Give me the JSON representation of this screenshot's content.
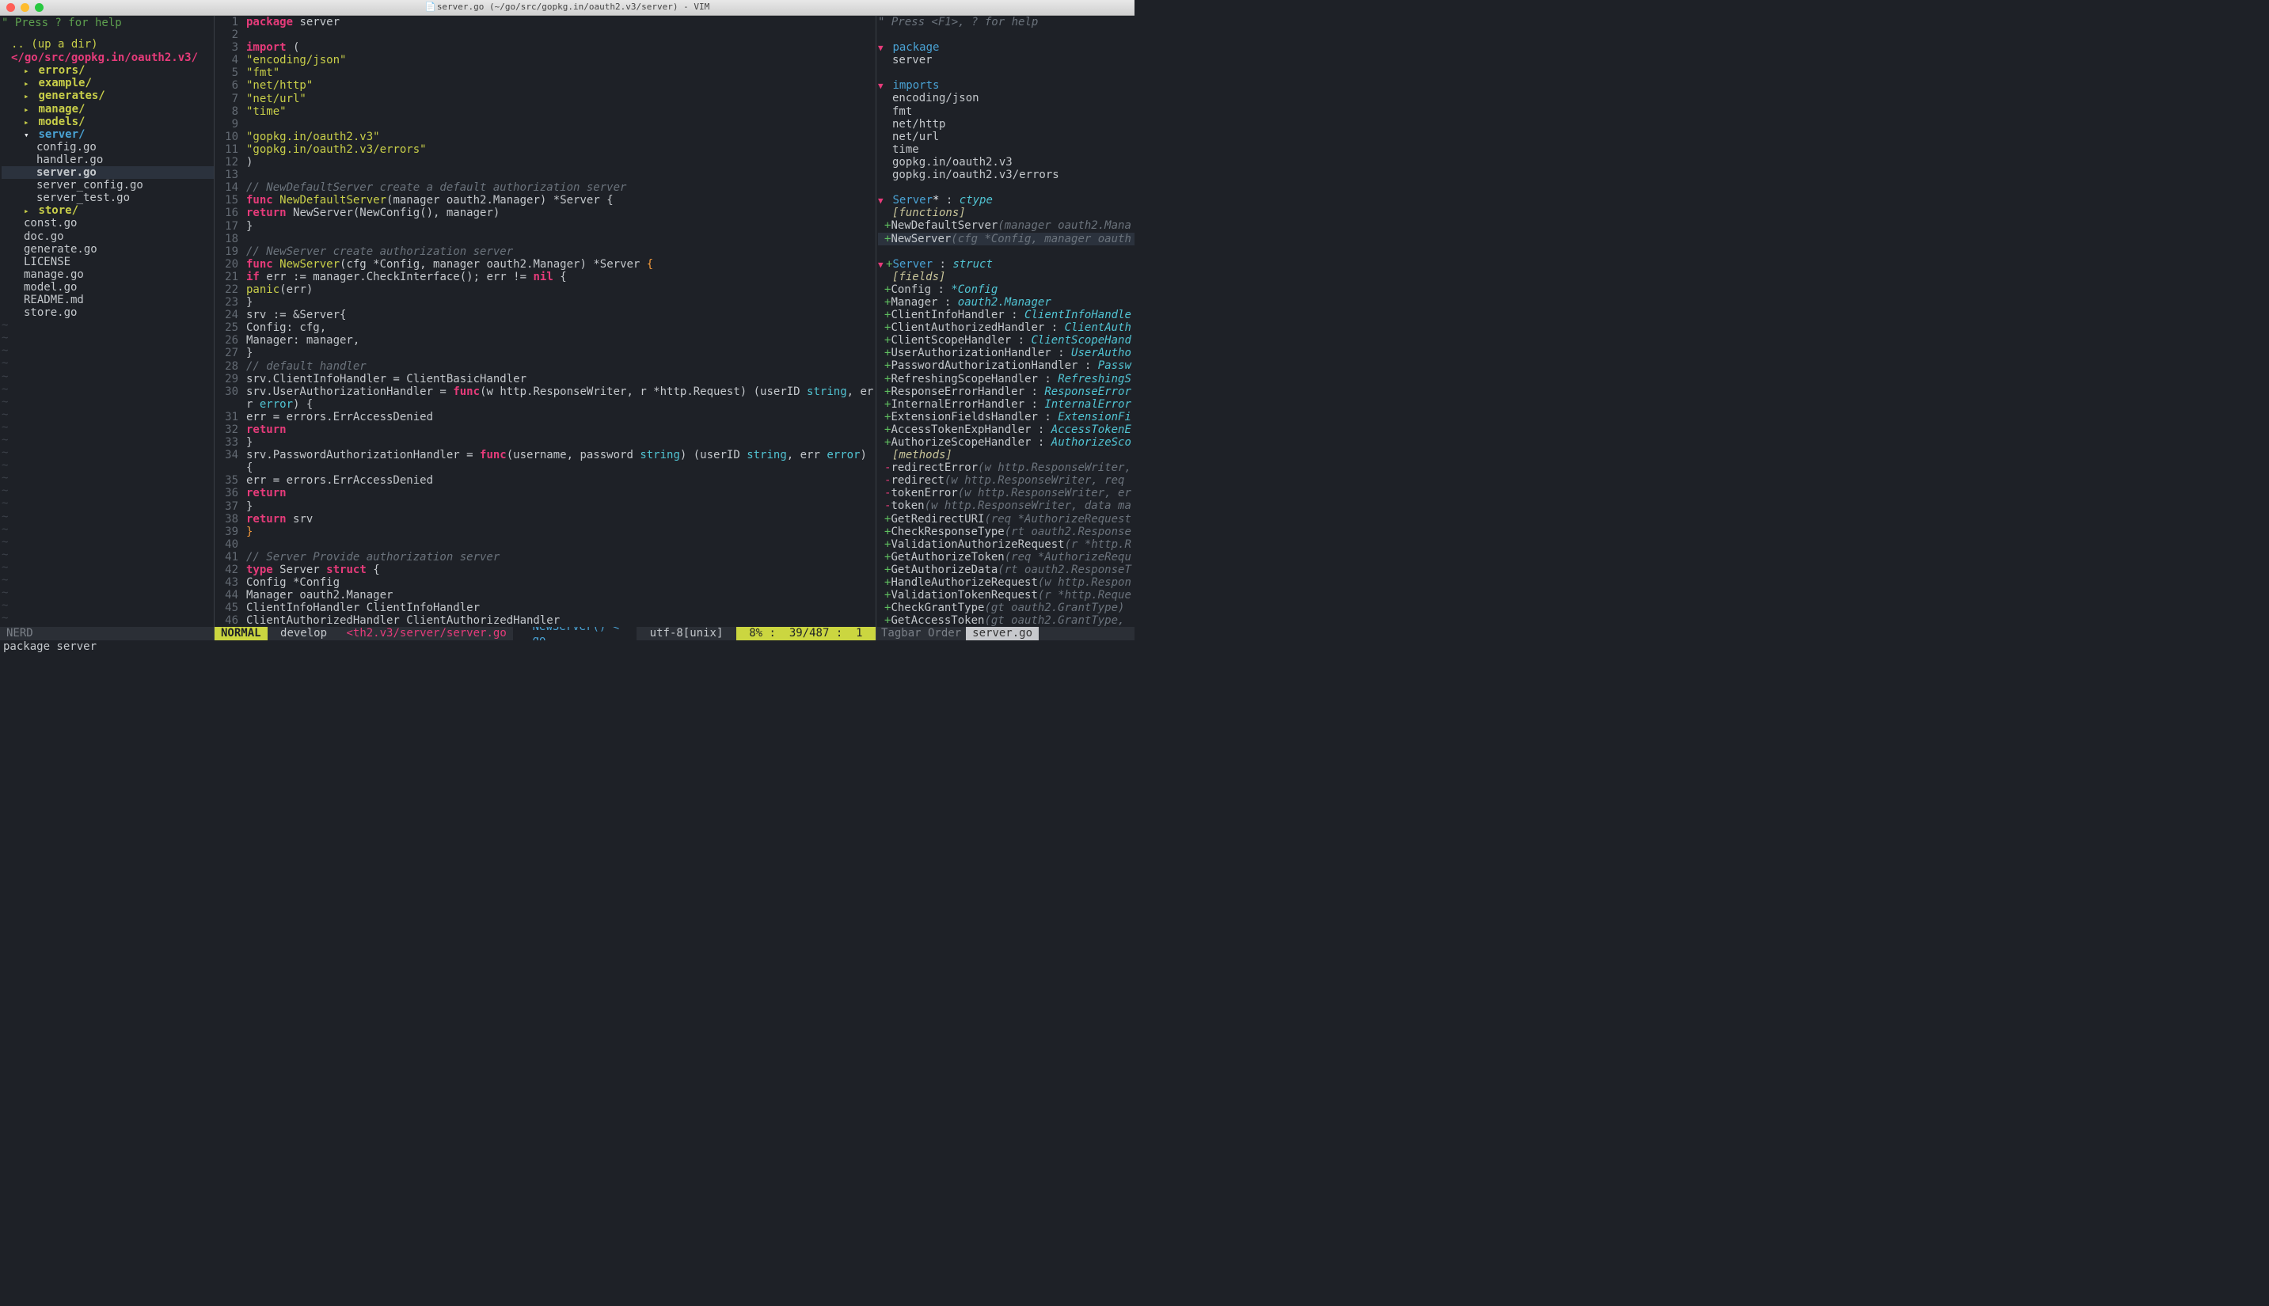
{
  "title": "server.go (~/go/src/gopkg.in/oauth2.v3/server) - VIM",
  "nerd": {
    "hint": "\" Press ? for help",
    "up": ".. (up a dir)",
    "root": "</go/src/gopkg.in/oauth2.v3/",
    "tree": [
      {
        "type": "dir",
        "name": "errors/",
        "expand": "right",
        "indent": 1
      },
      {
        "type": "dir",
        "name": "example/",
        "expand": "right",
        "indent": 1
      },
      {
        "type": "dir",
        "name": "generates/",
        "expand": "right",
        "indent": 1
      },
      {
        "type": "dir",
        "name": "manage/",
        "expand": "right",
        "indent": 1
      },
      {
        "type": "dir",
        "name": "models/",
        "expand": "right",
        "indent": 1
      },
      {
        "type": "dircur",
        "name": "server/",
        "expand": "down",
        "indent": 1
      },
      {
        "type": "file",
        "name": "config.go",
        "indent": 2
      },
      {
        "type": "file",
        "name": "handler.go",
        "indent": 2
      },
      {
        "type": "file",
        "name": "server.go",
        "indent": 2,
        "selected": true
      },
      {
        "type": "file",
        "name": "server_config.go",
        "indent": 2
      },
      {
        "type": "file",
        "name": "server_test.go",
        "indent": 2
      },
      {
        "type": "dir",
        "name": "store/",
        "expand": "right",
        "indent": 1
      },
      {
        "type": "file",
        "name": "const.go",
        "indent": 1
      },
      {
        "type": "file",
        "name": "doc.go",
        "indent": 1
      },
      {
        "type": "file",
        "name": "generate.go",
        "indent": 1
      },
      {
        "type": "file",
        "name": "LICENSE",
        "indent": 1
      },
      {
        "type": "file",
        "name": "manage.go",
        "indent": 1
      },
      {
        "type": "file",
        "name": "model.go",
        "indent": 1
      },
      {
        "type": "file",
        "name": "README.md",
        "indent": 1
      },
      {
        "type": "file",
        "name": "store.go",
        "indent": 1
      }
    ],
    "status": {
      "label": "NERD",
      "powerline": ""
    }
  },
  "code": {
    "lines": [
      {
        "n": "1",
        "h": "<span class='kw'>package</span> <span class='pl'>server</span>"
      },
      {
        "n": "2",
        "h": ""
      },
      {
        "n": "3",
        "h": "<span class='kw'>import</span> <span class='pl'>(</span>"
      },
      {
        "n": "4",
        "h": "    <span class='str'>\"encoding/json\"</span>"
      },
      {
        "n": "5",
        "h": "    <span class='str'>\"fmt\"</span>"
      },
      {
        "n": "6",
        "h": "    <span class='str'>\"net/http\"</span>"
      },
      {
        "n": "7",
        "h": "    <span class='str'>\"net/url\"</span>"
      },
      {
        "n": "8",
        "h": "    <span class='str'>\"time\"</span>"
      },
      {
        "n": "9",
        "h": ""
      },
      {
        "n": "10",
        "h": "    <span class='str'>\"gopkg.in/oauth2.v3\"</span>"
      },
      {
        "n": "11",
        "h": "    <span class='str'>\"gopkg.in/oauth2.v3/errors\"</span>"
      },
      {
        "n": "12",
        "h": "<span class='pl'>)</span>"
      },
      {
        "n": "13",
        "h": ""
      },
      {
        "n": "14",
        "h": "<span class='cmt'>// NewDefaultServer create a default authorization server</span>"
      },
      {
        "n": "15",
        "h": "<span class='kw'>func</span> <span class='fn'>NewDefaultServer</span>(manager <span class='pl'>oauth2.Manager</span>) *<span class='pl'>Server</span> {"
      },
      {
        "n": "16",
        "h": "    <span class='kw'>return</span> <span class='pl'>NewServer(NewConfig(), manager)</span>"
      },
      {
        "n": "17",
        "h": "<span class='pl'>}</span>"
      },
      {
        "n": "18",
        "h": ""
      },
      {
        "n": "19",
        "h": "<span class='cmt'>// NewServer create authorization server</span>"
      },
      {
        "n": "20",
        "h": "<span class='kw'>func</span> <span class='fn'>NewServer</span>(cfg *<span class='pl'>Config</span>, manager <span class='pl'>oauth2.Manager</span>) *<span class='pl'>Server</span> <span class='brace-cursor'>{</span>"
      },
      {
        "n": "21",
        "h": "    <span class='kw'>if</span> <span class='pl'>err := manager.CheckInterface(); err !=</span> <span class='kw'>nil</span> <span class='pl'>{</span>"
      },
      {
        "n": "22",
        "h": "        <span class='fn'>panic</span><span class='pl'>(err)</span>"
      },
      {
        "n": "23",
        "h": "    <span class='pl'>}</span>"
      },
      {
        "n": "24",
        "h": "    <span class='pl'>srv := &amp;Server{</span>"
      },
      {
        "n": "25",
        "h": "        <span class='pl'>Config:  cfg,</span>"
      },
      {
        "n": "26",
        "h": "        <span class='pl'>Manager: manager,</span>"
      },
      {
        "n": "27",
        "h": "    <span class='pl'>}</span>"
      },
      {
        "n": "28",
        "h": "    <span class='cmt'>// default handler</span>"
      },
      {
        "n": "29",
        "h": "    <span class='pl'>srv.ClientInfoHandler = ClientBasicHandler</span>"
      },
      {
        "n": "30",
        "h": "    <span class='pl'>srv.UserAuthorizationHandler =</span> <span class='kw'>func</span><span class='pl'>(w http.ResponseWriter, r *http.Request) (userID </span><span class='typ'>string</span><span class='pl'>, er</span>"
      },
      {
        "n": "",
        "h": "    <span class='pl'>r </span><span class='typ'>error</span><span class='pl'>) {</span>"
      },
      {
        "n": "31",
        "h": "        <span class='pl'>err = errors.ErrAccessDenied</span>"
      },
      {
        "n": "32",
        "h": "        <span class='kw'>return</span>"
      },
      {
        "n": "33",
        "h": "    <span class='pl'>}</span>"
      },
      {
        "n": "34",
        "h": "    <span class='pl'>srv.PasswordAuthorizationHandler =</span> <span class='kw'>func</span><span class='pl'>(username, password </span><span class='typ'>string</span><span class='pl'>) (userID </span><span class='typ'>string</span><span class='pl'>, err </span><span class='typ'>error</span><span class='pl'>)</span>"
      },
      {
        "n": "",
        "h": "     <span class='pl'>{</span>"
      },
      {
        "n": "35",
        "h": "        <span class='pl'>err = errors.ErrAccessDenied</span>"
      },
      {
        "n": "36",
        "h": "        <span class='kw'>return</span>"
      },
      {
        "n": "37",
        "h": "    <span class='pl'>}</span>"
      },
      {
        "n": "38",
        "h": "    <span class='kw'>return</span> <span class='pl'>srv</span>"
      },
      {
        "n": "39",
        "h": "<span class='brace-cursor'>}</span>"
      },
      {
        "n": "40",
        "h": ""
      },
      {
        "n": "41",
        "h": "<span class='cmt'>// Server Provide authorization server</span>"
      },
      {
        "n": "42",
        "h": "<span class='kw'>type</span> <span class='pl'>Server</span> <span class='kw'>struct</span> <span class='pl'>{</span>"
      },
      {
        "n": "43",
        "h": "    <span class='pl'>Config                   *Config</span>"
      },
      {
        "n": "44",
        "h": "    <span class='pl'>Manager                  oauth2.Manager</span>"
      },
      {
        "n": "45",
        "h": "    <span class='pl'>ClientInfoHandler        ClientInfoHandler</span>"
      },
      {
        "n": "46",
        "h": "    <span class='pl'>ClientAuthorizedHandler  ClientAuthorizedHandler</span>"
      }
    ]
  },
  "status": {
    "mode": "NORMAL",
    "branch": "develop",
    "path": "<th2.v3/server/server.go",
    "func": "NewServer() < go",
    "enc": "utf-8[unix]",
    "pct": "8%",
    "pos": "39/487",
    "col": "1"
  },
  "tagbar": {
    "hint": "\" Press <F1>, ? for help",
    "status": {
      "labels": "Tagbar   Order   ",
      "current": "server.go"
    },
    "rows": [
      {
        "type": "h",
        "mark": "tri-down",
        "html": "<span class='sect'>package</span>"
      },
      {
        "type": "p",
        "indent": 1,
        "html": "<span class='pl'>server</span>"
      },
      {
        "type": "sp"
      },
      {
        "type": "h",
        "mark": "tri-down",
        "html": "<span class='sect'>imports</span>"
      },
      {
        "type": "p",
        "indent": 1,
        "html": "<span class='pl'>encoding/json</span>"
      },
      {
        "type": "p",
        "indent": 1,
        "html": "<span class='pl'>fmt</span>"
      },
      {
        "type": "p",
        "indent": 1,
        "html": "<span class='pl'>net/http</span>"
      },
      {
        "type": "p",
        "indent": 1,
        "html": "<span class='pl'>net/url</span>"
      },
      {
        "type": "p",
        "indent": 1,
        "html": "<span class='pl'>time</span>"
      },
      {
        "type": "p",
        "indent": 1,
        "html": "<span class='pl'>gopkg.in/oauth2.v3</span>"
      },
      {
        "type": "p",
        "indent": 1,
        "html": "<span class='pl'>gopkg.in/oauth2.v3/errors</span>"
      },
      {
        "type": "sp"
      },
      {
        "type": "h",
        "mark": "tri-down",
        "html": "<span class='sect'>Server</span><span class='star'>*</span> <span class='colon'>:</span> <span class='ttype'>ctype</span>"
      },
      {
        "type": "p",
        "indent": 1,
        "html": "<span class='italbl'>[functions]</span>"
      },
      {
        "type": "p",
        "indent": 0,
        "mark": "plus",
        "html": "<span class='field'>NewDefaultServer</span><span class='itsig'>(manager oauth2.Mana</span>"
      },
      {
        "type": "p",
        "indent": 0,
        "mark": "plus",
        "hi": true,
        "html": "<span class='field'>NewServer</span><span class='itsig'>(cfg *Config, manager oauth</span>"
      },
      {
        "type": "sp"
      },
      {
        "type": "h",
        "mark": "tri-down+plus",
        "html": "<span class='sect'>Server</span> <span class='colon'>:</span> <span class='ttype'>struct</span>"
      },
      {
        "type": "p",
        "indent": 1,
        "html": "<span class='italbl'>[fields]</span>"
      },
      {
        "type": "p",
        "indent": 0,
        "mark": "plus",
        "html": "<span class='field'>Config</span> <span class='colon'>:</span> <span class='ttype'>*Config</span>"
      },
      {
        "type": "p",
        "indent": 0,
        "mark": "plus",
        "html": "<span class='field'>Manager</span> <span class='colon'>:</span> <span class='ttype'>oauth2.Manager</span>"
      },
      {
        "type": "p",
        "indent": 0,
        "mark": "plus",
        "html": "<span class='field'>ClientInfoHandler</span> <span class='colon'>:</span> <span class='ttype'>ClientInfoHandle</span>"
      },
      {
        "type": "p",
        "indent": 0,
        "mark": "plus",
        "html": "<span class='field'>ClientAuthorizedHandler</span> <span class='colon'>:</span> <span class='ttype'>ClientAuth</span>"
      },
      {
        "type": "p",
        "indent": 0,
        "mark": "plus",
        "html": "<span class='field'>ClientScopeHandler</span> <span class='colon'>:</span> <span class='ttype'>ClientScopeHand</span>"
      },
      {
        "type": "p",
        "indent": 0,
        "mark": "plus",
        "html": "<span class='field'>UserAuthorizationHandler</span> <span class='colon'>:</span> <span class='ttype'>UserAutho</span>"
      },
      {
        "type": "p",
        "indent": 0,
        "mark": "plus",
        "html": "<span class='field'>PasswordAuthorizationHandler</span> <span class='colon'>:</span> <span class='ttype'>Passw</span>"
      },
      {
        "type": "p",
        "indent": 0,
        "mark": "plus",
        "html": "<span class='field'>RefreshingScopeHandler</span> <span class='colon'>:</span> <span class='ttype'>RefreshingS</span>"
      },
      {
        "type": "p",
        "indent": 0,
        "mark": "plus",
        "html": "<span class='field'>ResponseErrorHandler</span> <span class='colon'>:</span> <span class='ttype'>ResponseError</span>"
      },
      {
        "type": "p",
        "indent": 0,
        "mark": "plus",
        "html": "<span class='field'>InternalErrorHandler</span> <span class='colon'>:</span> <span class='ttype'>InternalError</span>"
      },
      {
        "type": "p",
        "indent": 0,
        "mark": "plus",
        "html": "<span class='field'>ExtensionFieldsHandler</span> <span class='colon'>:</span> <span class='ttype'>ExtensionFi</span>"
      },
      {
        "type": "p",
        "indent": 0,
        "mark": "plus",
        "html": "<span class='field'>AccessTokenExpHandler</span> <span class='colon'>:</span> <span class='ttype'>AccessTokenE</span>"
      },
      {
        "type": "p",
        "indent": 0,
        "mark": "plus",
        "html": "<span class='field'>AuthorizeScopeHandler</span> <span class='colon'>:</span> <span class='ttype'>AuthorizeSco</span>"
      },
      {
        "type": "p",
        "indent": 1,
        "html": "<span class='italbl'>[methods]</span>"
      },
      {
        "type": "p",
        "indent": 0,
        "mark": "minus",
        "html": "<span class='field'>redirectError</span><span class='itsig'>(w http.ResponseWriter,</span>"
      },
      {
        "type": "p",
        "indent": 0,
        "mark": "minus",
        "html": "<span class='field'>redirect</span><span class='itsig'>(w http.ResponseWriter, req </span>"
      },
      {
        "type": "p",
        "indent": 0,
        "mark": "minus",
        "html": "<span class='field'>tokenError</span><span class='itsig'>(w http.ResponseWriter, er</span>"
      },
      {
        "type": "p",
        "indent": 0,
        "mark": "minus",
        "html": "<span class='field'>token</span><span class='itsig'>(w http.ResponseWriter, data ma</span>"
      },
      {
        "type": "p",
        "indent": 0,
        "mark": "plus",
        "html": "<span class='field'>GetRedirectURI</span><span class='itsig'>(req *AuthorizeRequest</span>"
      },
      {
        "type": "p",
        "indent": 0,
        "mark": "plus",
        "html": "<span class='field'>CheckResponseType</span><span class='itsig'>(rt oauth2.Response</span>"
      },
      {
        "type": "p",
        "indent": 0,
        "mark": "plus",
        "html": "<span class='field'>ValidationAuthorizeRequest</span><span class='itsig'>(r *http.R</span>"
      },
      {
        "type": "p",
        "indent": 0,
        "mark": "plus",
        "html": "<span class='field'>GetAuthorizeToken</span><span class='itsig'>(req *AuthorizeRequ</span>"
      },
      {
        "type": "p",
        "indent": 0,
        "mark": "plus",
        "html": "<span class='field'>GetAuthorizeData</span><span class='itsig'>(rt oauth2.ResponseT</span>"
      },
      {
        "type": "p",
        "indent": 0,
        "mark": "plus",
        "html": "<span class='field'>HandleAuthorizeRequest</span><span class='itsig'>(w http.Respon</span>"
      },
      {
        "type": "p",
        "indent": 0,
        "mark": "plus",
        "html": "<span class='field'>ValidationTokenRequest</span><span class='itsig'>(r *http.Reque</span>"
      },
      {
        "type": "p",
        "indent": 0,
        "mark": "plus",
        "html": "<span class='field'>CheckGrantType</span><span class='itsig'>(gt oauth2.GrantType)</span>"
      },
      {
        "type": "p",
        "indent": 0,
        "mark": "plus",
        "html": "<span class='field'>GetAccessToken</span><span class='itsig'>(gt oauth2.GrantType,</span>"
      }
    ]
  },
  "cmdline": "package server"
}
